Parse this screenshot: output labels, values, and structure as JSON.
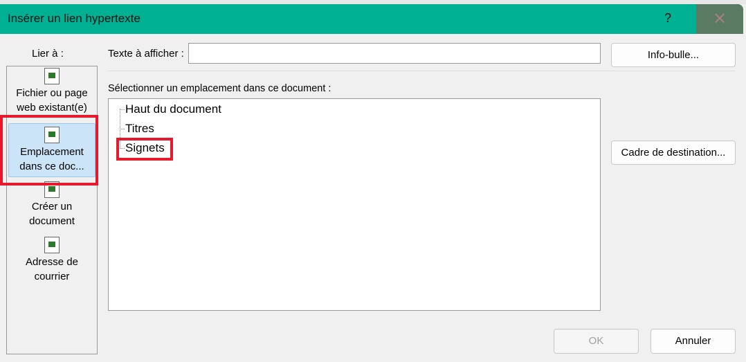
{
  "dialog": {
    "title": "Insérer un lien hypertexte",
    "help": "?",
    "close": "✕"
  },
  "link_to": {
    "label": "Lier à :",
    "items": [
      {
        "label1": "Fichier ou page",
        "label2": "web existant(e)"
      },
      {
        "label1": "Emplacement",
        "label2": "dans ce doc..."
      },
      {
        "label1": "Créer un",
        "label2": "document"
      },
      {
        "label1": "Adresse de",
        "label2": "courrier"
      }
    ]
  },
  "text_to_display": {
    "label": "Texte à afficher :",
    "value": ""
  },
  "screentip_button": "Info-bulle...",
  "location_label": "Sélectionner un emplacement dans ce document :",
  "tree": [
    "Haut du document",
    "Titres",
    "Signets"
  ],
  "target_frame_button": "Cadre de destination...",
  "ok_button": "OK",
  "cancel_button": "Annuler"
}
